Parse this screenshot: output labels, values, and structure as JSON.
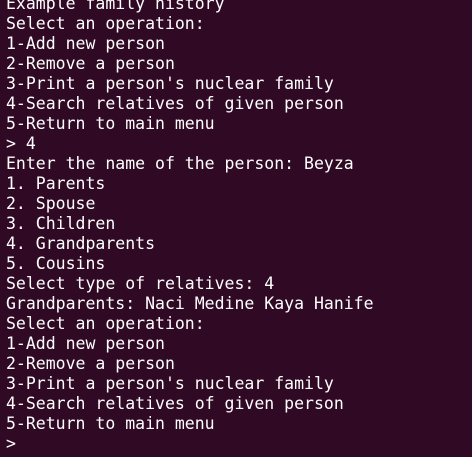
{
  "terminal": {
    "background": "#300a24",
    "foreground": "#ffffff",
    "lines": [
      "Example family history",
      "Select an operation:",
      "1-Add new person",
      "2-Remove a person",
      "3-Print a person's nuclear family",
      "4-Search relatives of given person",
      "5-Return to main menu",
      "> 4",
      "Enter the name of the person: Beyza",
      "1. Parents",
      "2. Spouse",
      "3. Children",
      "4. Grandparents",
      "5. Cousins",
      "Select type of relatives: 4",
      "Grandparents: Naci Medine Kaya Hanife",
      "Select an operation:",
      "1-Add new person",
      "2-Remove a person",
      "3-Print a person's nuclear family",
      "4-Search relatives of given person",
      "5-Return to main menu",
      ">"
    ]
  }
}
